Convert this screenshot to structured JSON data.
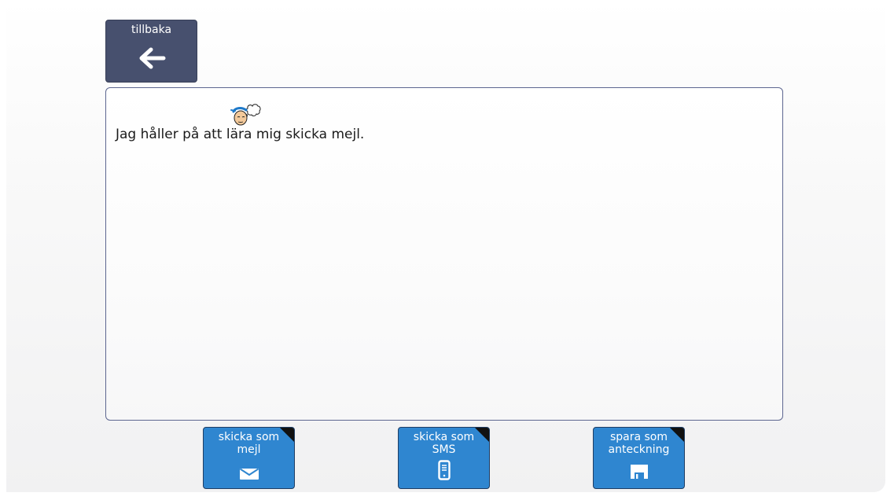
{
  "header": {
    "back_label": "tillbaka"
  },
  "editor": {
    "message": "Jag håller på att lära mig skicka mejl.",
    "symbol_icon": "thinking-person-icon"
  },
  "actions": [
    {
      "label": "skicka som mejl",
      "icon": "envelope-icon"
    },
    {
      "label": "skicka som SMS",
      "icon": "mobile-phone-icon"
    },
    {
      "label": "spara som anteckning",
      "icon": "floppy-disk-icon"
    }
  ],
  "colors": {
    "back_button": "#47506e",
    "action_button": "#2f86d0",
    "text_area_border": "#5d6690"
  }
}
